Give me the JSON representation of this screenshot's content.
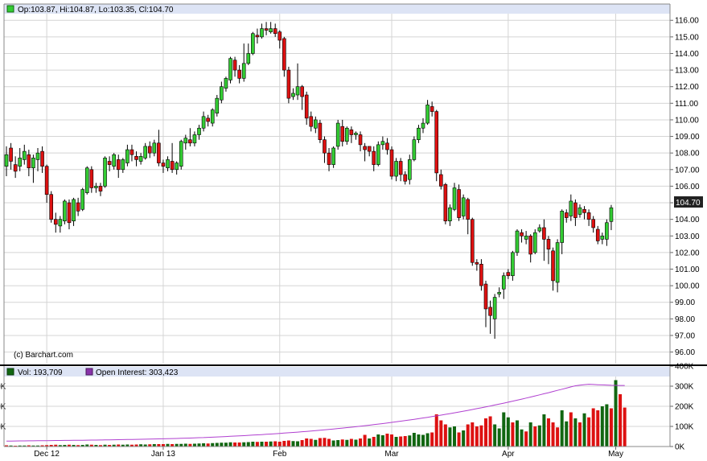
{
  "header": {
    "ohlc_label": "Op:103.87, Hi:104.87, Lo:103.35, Cl:104.70"
  },
  "watermark": "(c) Barchart.com",
  "last_price_label": "104.70",
  "volume_panel": {
    "vol_label": "Vol: 193,709",
    "oi_label": "Open Interest: 303,423"
  },
  "colors": {
    "up": "#33cc33",
    "down": "#dd1111",
    "grid": "#d4d4d4",
    "header_bg": "#dde4f5",
    "oi_line": "#b040d0",
    "vol_swatch": "#116611",
    "oi_swatch": "#8833aa",
    "last_label_bg": "#222222",
    "border": "#888888",
    "separator": "#000000"
  },
  "chart_data": [
    {
      "type": "candlestick",
      "ylim": [
        95.3,
        116.4
      ],
      "y_ticks": [
        "96.00",
        "97.00",
        "98.00",
        "99.00",
        "100.00",
        "101.00",
        "102.00",
        "103.00",
        "104.00",
        "105.00",
        "106.00",
        "107.00",
        "108.00",
        "109.00",
        "110.00",
        "111.00",
        "112.00",
        "113.00",
        "114.00",
        "115.00",
        "116.00"
      ],
      "x_labels": [
        "Dec 12",
        "Jan 13",
        "Feb",
        "Mar",
        "Apr",
        "May"
      ],
      "x_label_bar_index": [
        9,
        35,
        61,
        86,
        112,
        136
      ],
      "last_price": 104.7,
      "candles": [
        [
          107.2,
          107.9,
          106.6,
          108.4
        ],
        [
          108.3,
          107.5,
          107.0,
          108.6
        ],
        [
          107.3,
          106.9,
          106.5,
          107.8
        ],
        [
          107.2,
          107.7,
          106.9,
          108.3
        ],
        [
          107.6,
          108.1,
          107.3,
          108.5
        ],
        [
          107.9,
          107.1,
          106.6,
          108.2
        ],
        [
          107.1,
          107.7,
          106.2,
          107.9
        ],
        [
          107.6,
          108.0,
          106.9,
          108.3
        ],
        [
          108.1,
          107.2,
          106.8,
          108.4
        ],
        [
          107.2,
          105.5,
          105.0,
          107.3
        ],
        [
          105.5,
          104.0,
          103.8,
          105.7
        ],
        [
          104.0,
          103.7,
          103.2,
          104.4
        ],
        [
          103.6,
          104.0,
          103.2,
          104.2
        ],
        [
          103.9,
          105.1,
          103.7,
          105.2
        ],
        [
          105.0,
          103.8,
          103.4,
          105.2
        ],
        [
          103.9,
          105.2,
          103.6,
          105.3
        ],
        [
          105.0,
          104.5,
          104.2,
          105.3
        ],
        [
          104.6,
          105.8,
          104.5,
          105.9
        ],
        [
          105.6,
          107.1,
          105.5,
          107.2
        ],
        [
          107.0,
          105.9,
          105.6,
          107.2
        ],
        [
          105.9,
          106.0,
          105.6,
          106.2
        ],
        [
          106.0,
          105.7,
          105.4,
          106.2
        ],
        [
          106.0,
          107.7,
          105.9,
          107.8
        ],
        [
          107.5,
          107.3,
          106.9,
          107.8
        ],
        [
          107.2,
          107.9,
          107.0,
          108.0
        ],
        [
          107.6,
          107.0,
          106.5,
          107.9
        ],
        [
          107.0,
          107.6,
          106.8,
          107.7
        ],
        [
          107.4,
          108.2,
          107.2,
          108.5
        ],
        [
          108.2,
          107.9,
          107.5,
          108.5
        ],
        [
          107.8,
          107.6,
          107.2,
          108.1
        ],
        [
          107.5,
          107.8,
          107.3,
          108.0
        ],
        [
          107.7,
          108.4,
          107.6,
          108.6
        ],
        [
          108.4,
          108.0,
          107.7,
          108.7
        ],
        [
          108.0,
          108.6,
          107.8,
          108.8
        ],
        [
          108.6,
          107.4,
          107.2,
          109.4
        ],
        [
          107.4,
          107.2,
          106.8,
          107.6
        ],
        [
          107.1,
          107.6,
          106.9,
          107.8
        ],
        [
          107.5,
          107.0,
          106.8,
          108.6
        ],
        [
          107.0,
          107.4,
          106.7,
          107.5
        ],
        [
          107.2,
          108.7,
          107.0,
          108.8
        ],
        [
          108.6,
          108.9,
          108.2,
          109.1
        ],
        [
          108.8,
          108.6,
          108.4,
          109.5
        ],
        [
          108.6,
          109.1,
          108.4,
          109.3
        ],
        [
          109.1,
          109.5,
          108.8,
          109.7
        ],
        [
          109.5,
          110.2,
          109.3,
          110.5
        ],
        [
          110.1,
          109.9,
          109.6,
          110.3
        ],
        [
          109.8,
          110.6,
          109.6,
          110.7
        ],
        [
          110.4,
          111.3,
          110.2,
          111.5
        ],
        [
          111.2,
          112.0,
          111.0,
          112.3
        ],
        [
          111.9,
          112.5,
          111.7,
          112.6
        ],
        [
          112.4,
          113.7,
          112.2,
          113.8
        ],
        [
          113.6,
          113.0,
          112.6,
          113.8
        ],
        [
          113.0,
          112.5,
          112.2,
          113.3
        ],
        [
          112.5,
          113.4,
          112.3,
          114.6
        ],
        [
          113.4,
          114.0,
          113.3,
          114.6
        ],
        [
          114.0,
          115.2,
          113.9,
          115.3
        ],
        [
          115.1,
          115.0,
          114.6,
          115.5
        ],
        [
          115.0,
          115.5,
          114.9,
          115.8
        ],
        [
          115.5,
          115.4,
          115.1,
          115.9
        ],
        [
          115.3,
          115.5,
          115.2,
          115.9
        ],
        [
          115.5,
          115.2,
          115.0,
          115.8
        ],
        [
          115.3,
          114.8,
          114.3,
          115.4
        ],
        [
          114.9,
          113.0,
          112.6,
          115.0
        ],
        [
          113.0,
          111.3,
          111.0,
          113.2
        ],
        [
          111.4,
          111.6,
          111.2,
          111.9
        ],
        [
          111.5,
          112.0,
          111.2,
          113.4
        ],
        [
          112.0,
          111.4,
          110.6,
          112.1
        ],
        [
          111.5,
          110.1,
          109.7,
          111.7
        ],
        [
          110.2,
          109.6,
          109.3,
          110.5
        ],
        [
          109.5,
          110.0,
          109.2,
          110.2
        ],
        [
          109.8,
          108.8,
          108.6,
          110.0
        ],
        [
          108.8,
          108.0,
          107.4,
          109.0
        ],
        [
          108.0,
          107.3,
          106.9,
          108.3
        ],
        [
          107.3,
          108.3,
          107.1,
          108.4
        ],
        [
          108.4,
          109.8,
          108.2,
          110.0
        ],
        [
          109.6,
          108.7,
          108.4,
          110.0
        ],
        [
          108.7,
          109.5,
          108.5,
          109.6
        ],
        [
          109.4,
          109.1,
          108.6,
          109.6
        ],
        [
          109.1,
          109.2,
          108.8,
          109.3
        ],
        [
          109.1,
          108.5,
          108.1,
          109.3
        ],
        [
          108.4,
          108.2,
          107.5,
          108.6
        ],
        [
          108.4,
          108.1,
          107.8,
          108.3
        ],
        [
          108.1,
          107.3,
          106.9,
          108.4
        ],
        [
          107.3,
          108.5,
          107.2,
          108.7
        ],
        [
          108.5,
          108.7,
          108.2,
          109.0
        ],
        [
          108.6,
          108.2,
          107.9,
          108.9
        ],
        [
          108.2,
          106.6,
          106.4,
          108.4
        ],
        [
          106.6,
          107.5,
          106.3,
          107.7
        ],
        [
          107.5,
          106.7,
          106.3,
          107.7
        ],
        [
          106.7,
          106.3,
          106.1,
          106.9
        ],
        [
          106.4,
          107.6,
          106.1,
          107.9
        ],
        [
          107.6,
          108.8,
          107.5,
          109.0
        ],
        [
          108.8,
          109.5,
          108.6,
          109.7
        ],
        [
          109.5,
          109.8,
          109.2,
          110.1
        ],
        [
          109.8,
          110.9,
          109.7,
          111.2
        ],
        [
          110.8,
          110.5,
          110.2,
          111.1
        ],
        [
          110.5,
          106.8,
          106.3,
          110.6
        ],
        [
          106.7,
          106.0,
          105.8,
          107.0
        ],
        [
          106.1,
          103.9,
          103.7,
          106.2
        ],
        [
          103.9,
          104.7,
          103.6,
          104.9
        ],
        [
          104.6,
          105.9,
          104.5,
          106.2
        ],
        [
          105.8,
          104.1,
          103.9,
          106.1
        ],
        [
          104.2,
          105.3,
          104.0,
          105.5
        ],
        [
          105.2,
          104.0,
          103.1,
          105.3
        ],
        [
          104.0,
          101.4,
          101.2,
          104.1
        ],
        [
          101.4,
          101.3,
          100.9,
          101.6
        ],
        [
          101.3,
          100.0,
          99.7,
          101.6
        ],
        [
          100.1,
          98.6,
          97.5,
          100.3
        ],
        [
          98.7,
          98.2,
          97.1,
          99.1
        ],
        [
          98.0,
          99.3,
          96.8,
          99.5
        ],
        [
          99.5,
          99.6,
          99.3,
          99.9
        ],
        [
          99.8,
          100.6,
          99.2,
          100.8
        ],
        [
          100.8,
          100.6,
          100.4,
          101.0
        ],
        [
          100.6,
          102.0,
          100.3,
          102.1
        ],
        [
          102.0,
          103.3,
          101.8,
          103.4
        ],
        [
          103.2,
          103.0,
          102.6,
          103.4
        ],
        [
          102.8,
          103.0,
          102.5,
          103.3
        ],
        [
          103.0,
          101.9,
          101.4,
          103.1
        ],
        [
          102.0,
          103.2,
          101.9,
          103.4
        ],
        [
          103.3,
          103.5,
          103.2,
          103.7
        ],
        [
          103.5,
          102.8,
          101.5,
          104.0
        ],
        [
          102.8,
          102.2,
          101.3,
          103.0
        ],
        [
          102.1,
          100.3,
          99.7,
          102.3
        ],
        [
          100.2,
          102.6,
          99.6,
          102.8
        ],
        [
          102.6,
          104.5,
          101.9,
          104.6
        ],
        [
          104.4,
          104.1,
          103.8,
          104.6
        ],
        [
          104.2,
          105.1,
          103.9,
          105.5
        ],
        [
          105.0,
          104.1,
          103.6,
          105.2
        ],
        [
          104.3,
          104.7,
          104.1,
          104.9
        ],
        [
          104.6,
          104.4,
          104.0,
          104.8
        ],
        [
          104.4,
          104.0,
          103.6,
          104.6
        ],
        [
          104.0,
          103.5,
          103.2,
          104.2
        ],
        [
          103.4,
          102.7,
          102.5,
          103.6
        ],
        [
          102.8,
          103.0,
          102.5,
          103.2
        ],
        [
          102.8,
          103.8,
          102.4,
          104.0
        ],
        [
          103.87,
          104.7,
          103.35,
          104.87
        ]
      ]
    },
    {
      "type": "bar+line",
      "ylim": [
        0,
        400000
      ],
      "y_ticks": [
        "0K",
        "100K",
        "200K",
        "300K",
        "400K"
      ],
      "volume_last": 193709,
      "open_interest_last": 303423,
      "volume_up": [
        0,
        1,
        0,
        1,
        1,
        0,
        1,
        1,
        0,
        0,
        0,
        0,
        1,
        1,
        0,
        1,
        0,
        1,
        1,
        0,
        1,
        0,
        1,
        0,
        1,
        0,
        1,
        1,
        0,
        0,
        1,
        1,
        0,
        1,
        0,
        0,
        1,
        0,
        1,
        1,
        1,
        0,
        1,
        1,
        1,
        0,
        1,
        1,
        1,
        1,
        1,
        0,
        0,
        1,
        1,
        1,
        0,
        1,
        0,
        1,
        0,
        0,
        0,
        0,
        1,
        1,
        0,
        0,
        0,
        1,
        0,
        0,
        0,
        1,
        1,
        0,
        1,
        0,
        1,
        0,
        0,
        1,
        0,
        1,
        1,
        0,
        0,
        1,
        0,
        0,
        1,
        1,
        1,
        1,
        1,
        0,
        0,
        0,
        0,
        1,
        1,
        0,
        1,
        0,
        0,
        0,
        0,
        0,
        0,
        1,
        1,
        1,
        1,
        0,
        1,
        1,
        0,
        1,
        0,
        1,
        1,
        0,
        0,
        0,
        1,
        1,
        0,
        1,
        0,
        1,
        0,
        0,
        0,
        1,
        1,
        0,
        1
      ],
      "volume": [
        6000,
        5000,
        4000,
        5000,
        5000,
        6000,
        5000,
        5000,
        6000,
        7000,
        8000,
        9000,
        7000,
        8000,
        9000,
        8000,
        7000,
        8000,
        10000,
        9000,
        8000,
        7000,
        9000,
        8000,
        9000,
        10000,
        9000,
        10000,
        9000,
        10000,
        11000,
        10000,
        11000,
        12000,
        12000,
        12000,
        13000,
        12000,
        13000,
        13000,
        14000,
        13000,
        14000,
        15000,
        16000,
        15000,
        17000,
        18000,
        19000,
        19000,
        21000,
        20000,
        20000,
        21000,
        22000,
        24000,
        23000,
        24000,
        24000,
        25000,
        26000,
        24000,
        28000,
        30000,
        27000,
        26000,
        32000,
        40000,
        38000,
        33000,
        42000,
        43000,
        38000,
        30000,
        32000,
        35000,
        33000,
        38000,
        34000,
        40000,
        58000,
        40000,
        48000,
        60000,
        56000,
        64000,
        60000,
        48000,
        50000,
        52000,
        55000,
        68000,
        60000,
        58000,
        66000,
        70000,
        160000,
        130000,
        110000,
        95000,
        100000,
        70000,
        80000,
        110000,
        120000,
        100000,
        105000,
        140000,
        150000,
        110000,
        90000,
        170000,
        145000,
        120000,
        130000,
        85000,
        75000,
        120000,
        100000,
        105000,
        160000,
        140000,
        120000,
        95000,
        180000,
        125000,
        170000,
        140000,
        120000,
        165000,
        145000,
        190000,
        180000,
        200000,
        210000,
        190000,
        330000,
        260000,
        193709
      ],
      "open_interest": [
        27000,
        27300,
        27600,
        27900,
        28100,
        28300,
        28600,
        28800,
        29000,
        29300,
        29500,
        29800,
        30000,
        30300,
        30500,
        30800,
        31000,
        31300,
        31500,
        31800,
        32000,
        32400,
        32700,
        33100,
        33500,
        34000,
        34400,
        34800,
        35200,
        35600,
        36000,
        36500,
        37000,
        37500,
        38000,
        38500,
        39000,
        39600,
        40200,
        40800,
        41500,
        42200,
        43000,
        43800,
        44600,
        45500,
        46500,
        47500,
        48500,
        49600,
        50700,
        51900,
        53000,
        54200,
        55400,
        56700,
        58000,
        59300,
        60700,
        62100,
        63600,
        65100,
        66700,
        68300,
        70000,
        71700,
        73400,
        75200,
        77100,
        79000,
        81000,
        83000,
        85100,
        87200,
        89400,
        91600,
        93900,
        96200,
        98600,
        101000,
        103500,
        106100,
        108700,
        111400,
        114200,
        117000,
        119900,
        122800,
        125800,
        128900,
        132000,
        135200,
        138500,
        141900,
        145300,
        148800,
        152400,
        156100,
        159800,
        163600,
        167500,
        171500,
        175600,
        179700,
        183900,
        188200,
        192600,
        197100,
        201600,
        206200,
        210900,
        215700,
        220600,
        225500,
        230500,
        235600,
        240800,
        246100,
        251400,
        256800,
        262300,
        267800,
        273400,
        279100,
        284800,
        290600,
        296400,
        301900,
        305000,
        307800,
        309500,
        308400,
        307300,
        306300,
        305400,
        304600,
        303900,
        303423,
        303423
      ]
    }
  ]
}
